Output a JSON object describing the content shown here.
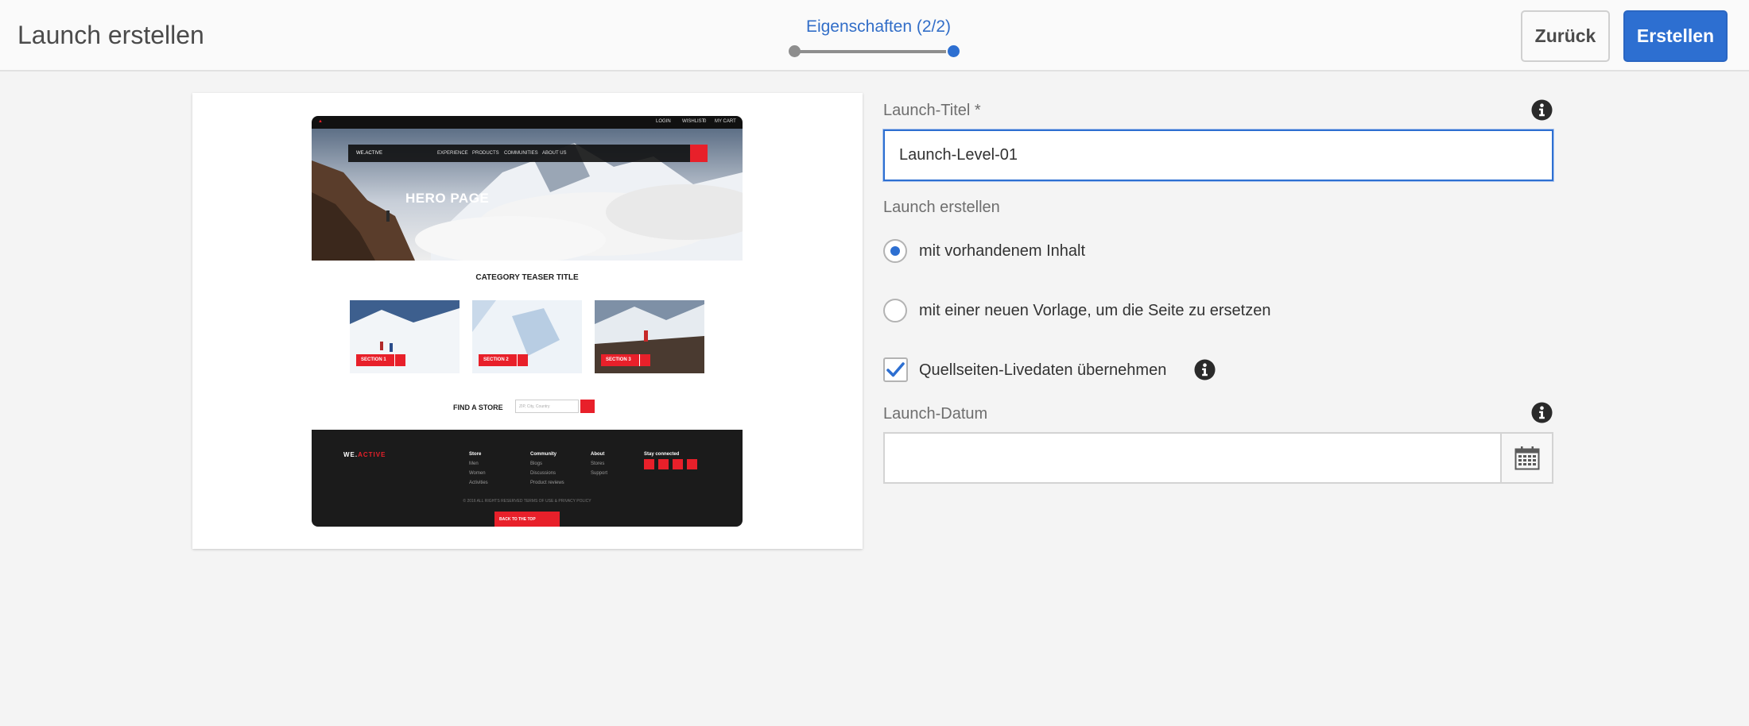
{
  "header": {
    "title": "Launch erstellen",
    "wizard_step": "Eigenschaften (2/2)",
    "back_label": "Zurück",
    "create_label": "Erstellen"
  },
  "preview": {
    "topbar_links": [
      "LOGIN",
      "WISHLIST",
      "0",
      "MY CART"
    ],
    "nav_brand": "WE.ACTIVE",
    "nav_items": [
      "EXPERIENCE",
      "PRODUCTS",
      "COMMUNITIES",
      "ABOUT US"
    ],
    "hero_title": "HERO PAGE",
    "category_title": "CATEGORY TEASER TITLE",
    "sections": [
      "SECTION 1",
      "SECTION 2",
      "SECTION 3"
    ],
    "find_store": "FIND A STORE",
    "find_placeholder": "ZIP, City, Country",
    "footer_logo_prefix": "WE.",
    "footer_logo_accent": "ACTIVE",
    "footer_columns": [
      {
        "title": "Store",
        "items": [
          "Men",
          "Women",
          "Activities"
        ]
      },
      {
        "title": "Community",
        "items": [
          "Blogs",
          "Discussions",
          "Product reviews"
        ]
      },
      {
        "title": "About",
        "items": [
          "Stores",
          "Support"
        ]
      },
      {
        "title": "Stay connected",
        "items": []
      }
    ],
    "copyright": "© 2016 ALL RIGHTS RESERVED      TERMS OF USE & PRIVACY POLICY",
    "back_to_top": "BACK TO THE TOP"
  },
  "form": {
    "title_label": "Launch-Titel *",
    "title_value": "Launch-Level-01",
    "create_label": "Launch erstellen",
    "option_existing": "mit vorhandenem Inhalt",
    "option_new_template": "mit einer neuen Vorlage, um die Seite zu ersetzen",
    "inherit_label": "Quellseiten-Livedaten übernehmen",
    "date_label": "Launch-Datum",
    "date_value": ""
  },
  "colors": {
    "accent": "#2d6fd1",
    "brand_red": "#e8202a"
  },
  "icons": [
    "info-icon",
    "calendar-icon",
    "check-icon"
  ]
}
